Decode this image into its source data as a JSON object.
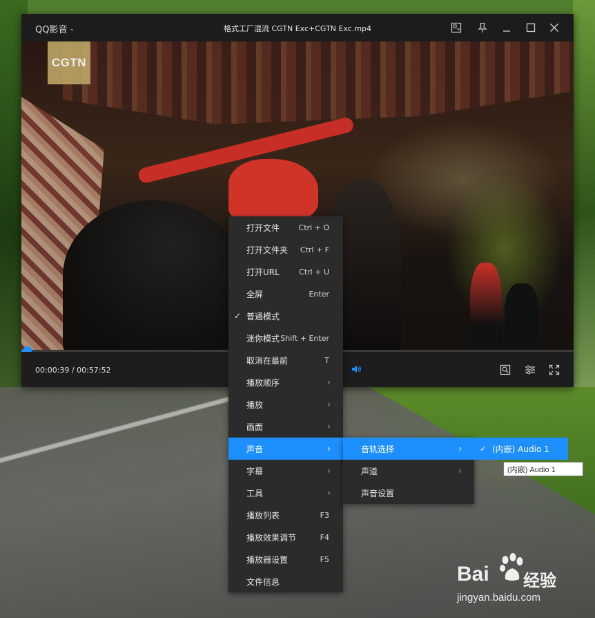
{
  "window": {
    "app_name": "QQ影音",
    "file_title": "格式工厂混流 CGTN Exc+CGTN Exc.mp4"
  },
  "video": {
    "logo_text": "CGTN"
  },
  "playback": {
    "current_time": "00:00:39",
    "separator": " / ",
    "total_time": "00:57:52",
    "progress_fraction": 0.011
  },
  "context_menu": {
    "items": [
      {
        "label": "打开文件",
        "shortcut": "Ctrl + O"
      },
      {
        "label": "打开文件夹",
        "shortcut": "Ctrl + F"
      },
      {
        "label": "打开URL",
        "shortcut": "Ctrl + U"
      },
      {
        "label": "全屏",
        "shortcut": "Enter"
      },
      {
        "label": "普通模式",
        "checked": true
      },
      {
        "label": "迷你模式",
        "shortcut": "Shift + Enter"
      },
      {
        "label": "取消在最前",
        "shortcut": "T"
      },
      {
        "label": "播放顺序",
        "submenu": true
      },
      {
        "label": "播放",
        "submenu": true
      },
      {
        "label": "画面",
        "submenu": true
      },
      {
        "label": "声音",
        "submenu": true,
        "active": true
      },
      {
        "label": "字幕",
        "submenu": true
      },
      {
        "label": "工具",
        "submenu": true
      },
      {
        "label": "播放列表",
        "shortcut": "F3"
      },
      {
        "label": "播放效果调节",
        "shortcut": "F4"
      },
      {
        "label": "播放器设置",
        "shortcut": "F5"
      },
      {
        "label": "文件信息"
      }
    ]
  },
  "sound_submenu": {
    "items": [
      {
        "label": "音轨选择",
        "submenu": true,
        "active": true
      },
      {
        "label": "声道",
        "submenu": true
      },
      {
        "label": "声音设置"
      }
    ]
  },
  "audio_track_submenu": {
    "items": [
      {
        "label": "(内嵌) Audio 1",
        "checked": true,
        "active": true
      }
    ]
  },
  "tooltip": {
    "text": "(内嵌) Audio 1"
  },
  "watermark": {
    "brand": "Bai",
    "brand_cn": "经验",
    "url": "jingyan.baidu.com"
  },
  "colors": {
    "accent": "#1e8fff",
    "menu_bg": "#2b2b2b",
    "window_bg": "#1c1c1c"
  }
}
